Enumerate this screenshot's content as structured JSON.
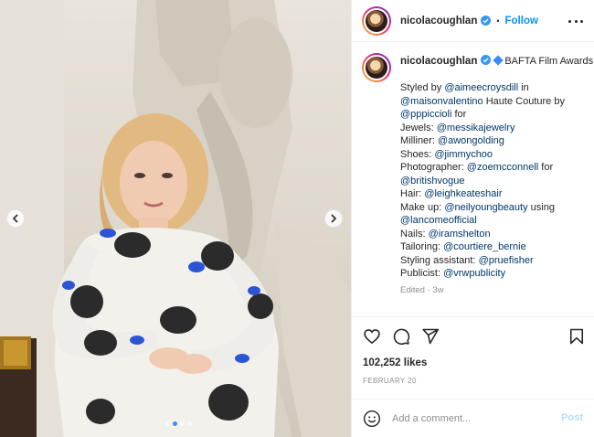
{
  "post": {
    "username": "nicolacoughlan",
    "follow_label": "Follow",
    "separator": "•",
    "caption_title": "BAFTA Film Awards",
    "caption_lines": [
      [
        {
          "t": "Styled by "
        },
        {
          "t": "@aimeecroysdill",
          "m": true
        },
        {
          "t": " in"
        }
      ],
      [
        {
          "t": "@maisonvalentino",
          "m": true
        },
        {
          "t": " Haute Couture by"
        }
      ],
      [
        {
          "t": "@pppiccioli",
          "m": true
        },
        {
          "t": " for"
        }
      ],
      [
        {
          "t": "Jewels: "
        },
        {
          "t": "@messikajewelry",
          "m": true
        }
      ],
      [
        {
          "t": "Milliner: "
        },
        {
          "t": "@awongolding",
          "m": true
        }
      ],
      [
        {
          "t": "Shoes: "
        },
        {
          "t": "@jimmychoo",
          "m": true
        }
      ],
      [
        {
          "t": "Photographer: "
        },
        {
          "t": "@zoemcconnell",
          "m": true
        },
        {
          "t": " for"
        }
      ],
      [
        {
          "t": "@britishvogue",
          "m": true
        }
      ],
      [
        {
          "t": "Hair: "
        },
        {
          "t": "@leighkeateshair",
          "m": true
        }
      ],
      [
        {
          "t": "Make up: "
        },
        {
          "t": "@neilyoungbeauty",
          "m": true
        },
        {
          "t": " using"
        }
      ],
      [
        {
          "t": "@lancomeofficial",
          "m": true
        }
      ],
      [
        {
          "t": "Nails: "
        },
        {
          "t": "@iramshelton",
          "m": true
        }
      ],
      [
        {
          "t": "Tailoring: "
        },
        {
          "t": "@courtiere_bernie",
          "m": true
        }
      ],
      [
        {
          "t": "Styling assistant: "
        },
        {
          "t": "@pruefisher",
          "m": true
        }
      ],
      [
        {
          "t": "Publicist: "
        },
        {
          "t": "@vrwpublicity",
          "m": true
        }
      ]
    ],
    "edited_label": "Edited · 3w",
    "likes": "102,252 likes",
    "date": "FEBRUARY 20"
  },
  "comment": {
    "placeholder": "Add a comment...",
    "post_label": "Post"
  },
  "carousel": {
    "total_slides": 4,
    "active_slide": 2
  },
  "icons": {
    "like": "heart-icon",
    "comment": "comment-icon",
    "share": "share-icon",
    "save": "bookmark-icon",
    "emoji": "smiley-icon",
    "more": "more-options-icon",
    "verified": "verified-badge-icon",
    "prev": "chevron-left-icon",
    "next": "chevron-right-icon"
  },
  "colors": {
    "accent": "#0095f6",
    "mention": "#00376b",
    "muted": "#8e8e8e",
    "verified": "#3897f0"
  }
}
